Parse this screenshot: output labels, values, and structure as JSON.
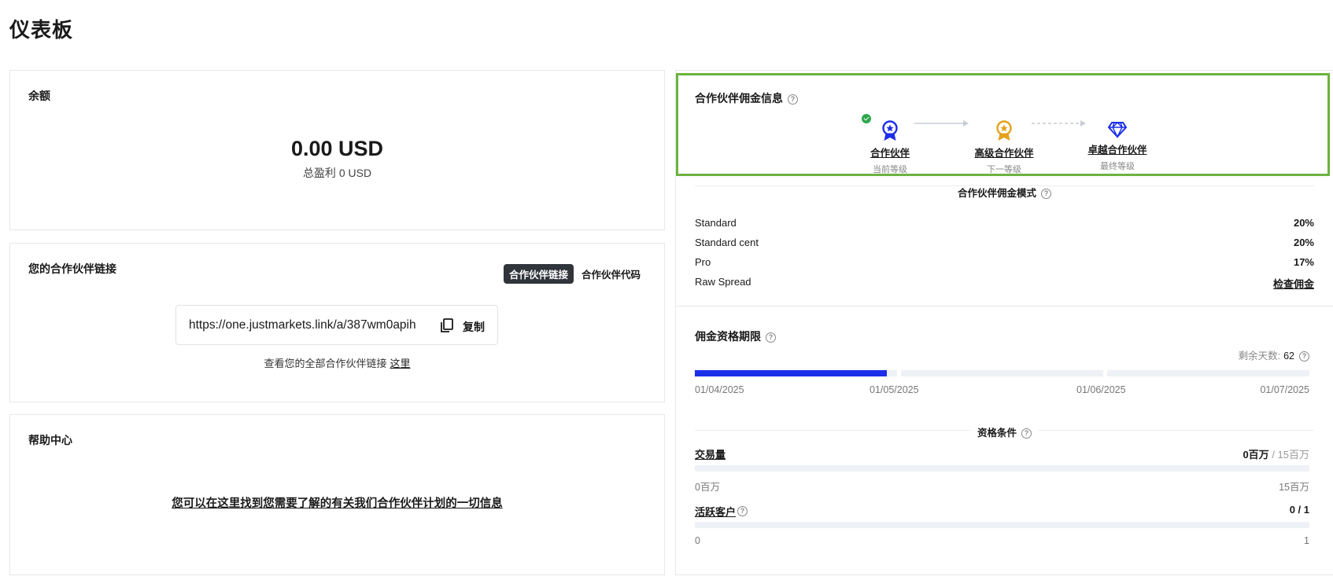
{
  "page": {
    "title": "仪表板"
  },
  "balance": {
    "title": "余额",
    "amount": "0.00 USD",
    "total_profit": "总盈利 0 USD"
  },
  "partner_link": {
    "title": "您的合作伙伴链接",
    "tabs": [
      {
        "label": "合作伙伴链接",
        "active": true
      },
      {
        "label": "合作伙伴代码",
        "active": false
      }
    ],
    "url": "https://one.justmarkets.link/a/387wm0apih",
    "copy_label": "复制",
    "hint_text": "查看您的全部合作伙伴链接",
    "hint_link": "这里"
  },
  "help": {
    "title": "帮助中心",
    "link_text": "您可以在这里找到您需要了解的有关我们合作伙伴计划的一切信息"
  },
  "commission": {
    "title": "合作伙伴佣金信息",
    "tiers": [
      {
        "name": "合作伙伴",
        "sub": "当前等级",
        "icon": "medal-blue-icon",
        "color": "#1c2fe8"
      },
      {
        "name": "高级合作伙伴",
        "sub": "下一等级",
        "icon": "medal-gold-icon",
        "color": "#e5a21c"
      },
      {
        "name": "卓越合作伙伴",
        "sub": "最终等级",
        "icon": "diamond-icon",
        "color": "#1c2fe8"
      }
    ],
    "mode_title": "合作伙伴佣金模式",
    "plans": [
      {
        "name": "Standard",
        "value": "20%"
      },
      {
        "name": "Standard cent",
        "value": "20%"
      },
      {
        "name": "Pro",
        "value": "17%"
      },
      {
        "name": "Raw Spread",
        "value": "检查佣金"
      }
    ]
  },
  "qualification": {
    "title": "佣金资格期限",
    "days_label": "剩余天数:",
    "days_value": "62",
    "timeline_dates": [
      "01/04/2025",
      "01/05/2025",
      "01/06/2025",
      "01/07/2025"
    ],
    "timeline_progress": 0.95,
    "conditions_title": "资格条件",
    "conditions": [
      {
        "name": "交易量",
        "current": "0百万",
        "target": "/ 15百万",
        "min": "0百万",
        "max": "15百万",
        "progress": 0
      },
      {
        "name": "活跃客户",
        "current": "0 / 1",
        "target": "",
        "min": "0",
        "max": "1",
        "progress": 0
      }
    ]
  },
  "colors": {
    "accent": "#1c2fe8",
    "highlight": "#6cb33f",
    "gold": "#e5a21c",
    "success": "#2aa84a"
  }
}
